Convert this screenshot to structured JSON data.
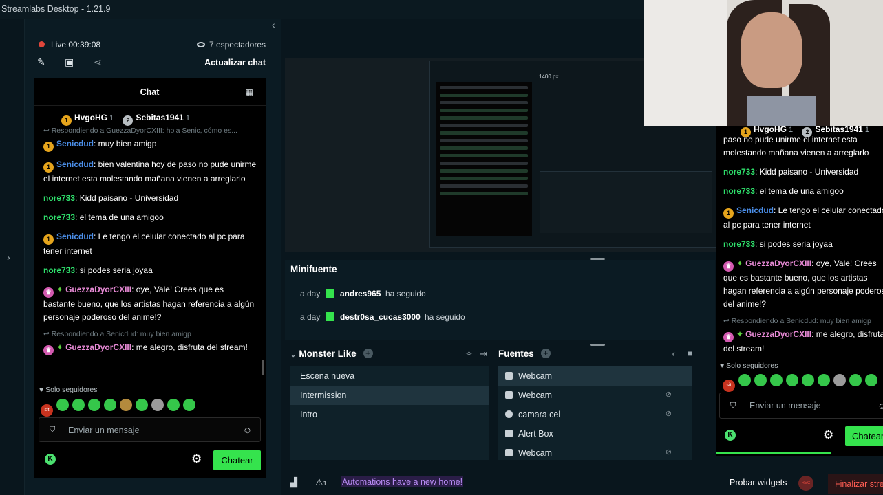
{
  "window": {
    "title": "Streamlabs Desktop - 1.21.9"
  },
  "status": {
    "live": "Live 00:39:08",
    "viewers": "7 espectadores",
    "refresh": "Actualizar chat"
  },
  "chat": {
    "title": "Chat",
    "top_users": [
      {
        "rank_badge": "1",
        "name": "HvgoHG",
        "count": "1"
      },
      {
        "rank_badge": "2",
        "name": "Sebitas1941",
        "count": "1"
      }
    ],
    "reply_1": "↩ Respondiendo a GuezzaDyorCXIII: hola Senic, cómo es...",
    "messages": [
      {
        "badge": "1",
        "user": "Senicdud",
        "text": ": muy bien amigp"
      },
      {
        "badge": "1",
        "user": "Senicdud",
        "text": ": bien valentina hoy de paso no pude unirme el internet esta molestando mañana vienen a arreglarlo"
      },
      {
        "user": "nore733",
        "text": ": Kidd paisano - Universidad"
      },
      {
        "user": "nore733",
        "text": ": el tema de una amigoo"
      },
      {
        "badge": "1",
        "user": "Senicdud",
        "text": ": Le tengo el celular conectado al pc para tener internet"
      },
      {
        "user": "nore733",
        "text": ": si podes seria joyaa"
      },
      {
        "user": "GuezzaDyorCXIII",
        "text": ": oye, Vale! Crees que es bastante bueno, que los artistas hagan referencia a algún personaje poderoso del anime!?"
      },
      {
        "user": "GuezzaDyorCXIII",
        "text": ": me alegro, disfruta del stream!"
      }
    ],
    "reply_2": "↩ Respondiendo a Senicdud: muy bien amigp",
    "solo": "♥ Solo seguidores",
    "emote_first": "sit",
    "input_placeholder": "Enviar un mensaje",
    "send": "Chatear"
  },
  "preview": {
    "width_label": "1400 px"
  },
  "minifuente": {
    "title": "Minifuente",
    "events": [
      {
        "ago": "a day",
        "user": "andres965",
        "action": "ha seguido"
      },
      {
        "ago": "a day",
        "user": "destr0sa_cucas3000",
        "action": "ha seguido"
      }
    ]
  },
  "scenes": {
    "title": "Monster Like",
    "items": [
      "Escena nueva",
      "Intermission",
      "Intro"
    ]
  },
  "sources": {
    "title": "Fuentes",
    "items": [
      "Webcam",
      "Webcam",
      "camara cel",
      "Alert Box",
      "Webcam"
    ]
  },
  "right_chat": {
    "top_users": [
      {
        "name": "HvgoHG",
        "count": "1"
      },
      {
        "name": "Sebitas1941",
        "count": "1"
      }
    ],
    "messages": [
      {
        "user": "",
        "text": "paso no pude unirme el internet esta molestando mañana vienen a arreglarlo"
      },
      {
        "user": "nore733",
        "text": ": Kidd paisano - Universidad"
      },
      {
        "user": "nore733",
        "text": ": el tema de una amigoo"
      },
      {
        "user": "Senicdud",
        "text": ": Le tengo el celular conectado al pc para tener internet"
      },
      {
        "user": "nore733",
        "text": ": si podes seria joyaa"
      },
      {
        "user": "GuezzaDyorCXIII",
        "text": ": oye, Vale! Crees que es bastante bueno, que los artistas hagan referencia a algún personaje poderoso del anime!?"
      },
      {
        "user": "GuezzaDyorCXIII",
        "text": ": me alegro, disfruta del stream!"
      }
    ],
    "reply": "↩ Respondiendo a Senicdud: muy bien amigp",
    "solo": "♥ Solo seguidores",
    "emote_first": "sit",
    "input_placeholder": "Enviar un mensaje",
    "send": "Chatear"
  },
  "bottom": {
    "notice": "Automations have a new home!",
    "probar": "Probar widgets",
    "rec": "REC",
    "finalizar": "Finalizar stre",
    "alert_count": "1"
  },
  "colors": {
    "accent_green": "#35e34d",
    "live_red": "#e0463b",
    "panel": "#0b1b23"
  }
}
